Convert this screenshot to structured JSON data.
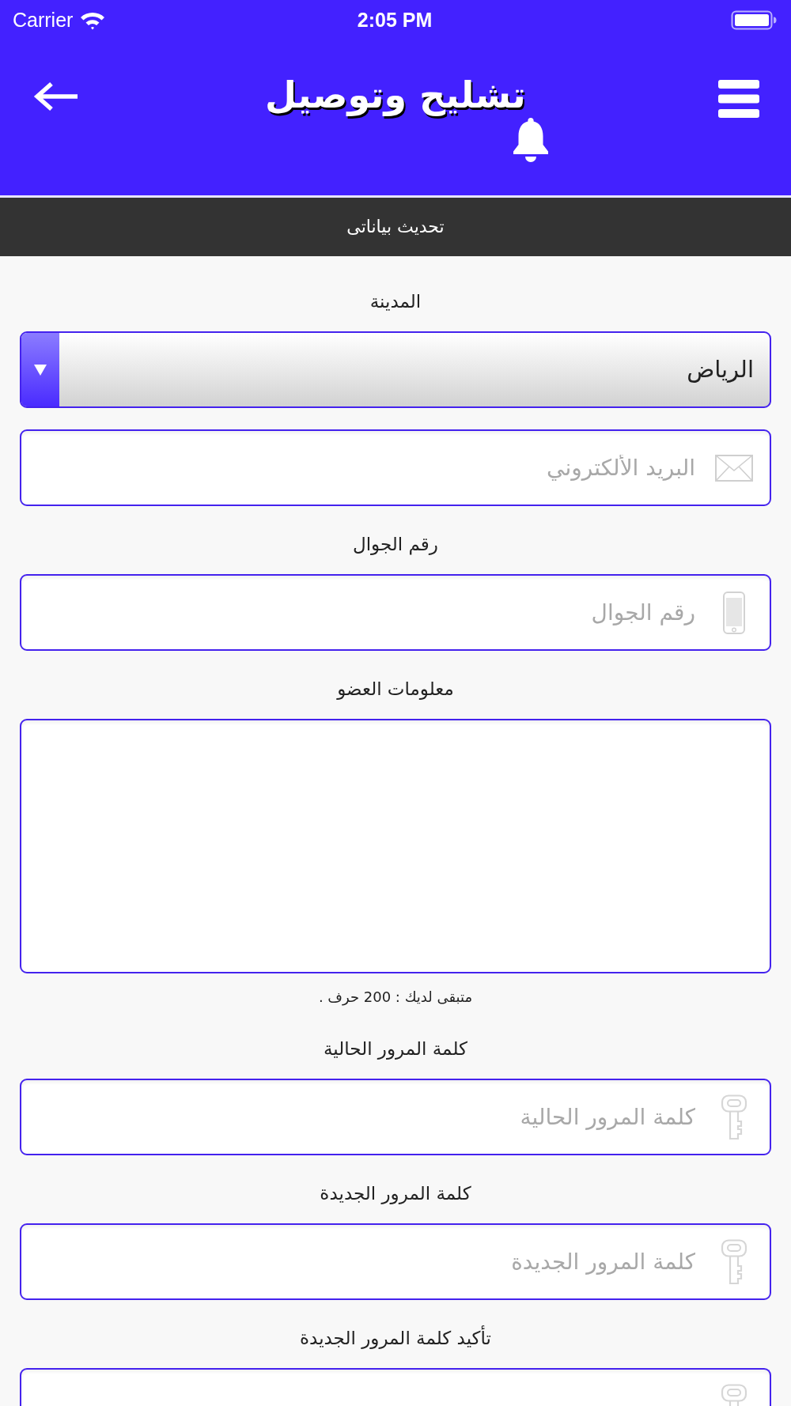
{
  "status_bar": {
    "carrier": "Carrier",
    "time": "2:05 PM"
  },
  "header": {
    "title": "تشليح وتوصيل"
  },
  "section_bar": {
    "title": "تحديث بياناتى"
  },
  "form": {
    "fields": [
      {
        "kind": "select",
        "label": "المدينة",
        "value": "الرياض"
      },
      {
        "kind": "email",
        "placeholder": "البريد الألكتروني"
      },
      {
        "kind": "phone",
        "label": "رقم الجوال",
        "placeholder": "رقم الجوال"
      },
      {
        "kind": "textarea",
        "label": "معلومات العضو",
        "counter": "متبقى لديك : 200 حرف ."
      },
      {
        "kind": "password",
        "label": "كلمة المرور الحالية",
        "placeholder": "كلمة المرور الحالية"
      },
      {
        "kind": "password",
        "label": "كلمة المرور الجديدة",
        "placeholder": "كلمة المرور الجديدة"
      },
      {
        "kind": "password",
        "label": "تأكيد كلمة المرور الجديدة"
      }
    ]
  }
}
